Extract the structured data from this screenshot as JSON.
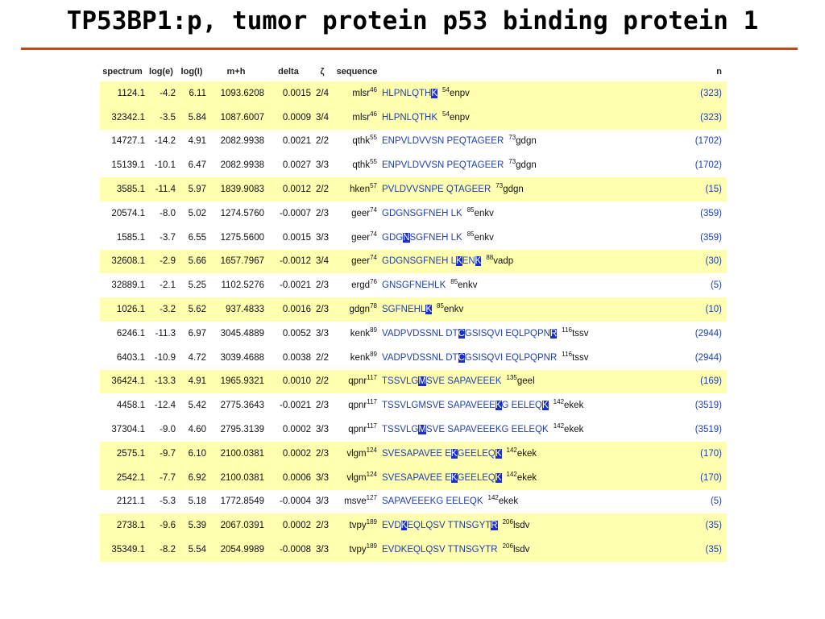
{
  "title": "TP53BP1:p, tumor protein p53 binding protein 1",
  "table": {
    "headers": [
      "spectrum",
      "log(e)",
      "log(I)",
      "m+h",
      "delta",
      "ζ",
      "sequence",
      "n"
    ],
    "rows": [
      {
        "spectrum": "1124.1",
        "loge": "-4.2",
        "logi": "6.11",
        "mh": "1093.6208",
        "delta": "0.0015",
        "z": "2/4",
        "pre": "mlsr",
        "pre_pos": "46",
        "seq_parts": [
          {
            "t": "HLPNLQTH",
            "m": false
          },
          {
            "t": "K",
            "m": true
          }
        ],
        "post_pos": "54",
        "post": "enpv",
        "n": "(323)",
        "hl": true
      },
      {
        "spectrum": "32342.1",
        "loge": "-3.5",
        "logi": "5.84",
        "mh": "1087.6007",
        "delta": "0.0009",
        "z": "3/4",
        "pre": "mlsr",
        "pre_pos": "46",
        "seq_parts": [
          {
            "t": "HLPNLQTHK",
            "m": false
          }
        ],
        "post_pos": "54",
        "post": "enpv",
        "n": "(323)",
        "hl": true
      },
      {
        "spectrum": "14727.1",
        "loge": "-14.2",
        "logi": "4.91",
        "mh": "2082.9938",
        "delta": "0.0021",
        "z": "2/2",
        "pre": "qthk",
        "pre_pos": "55",
        "seq_parts": [
          {
            "t": "ENPVLDVVSN PEQTAGEER",
            "m": false
          }
        ],
        "post_pos": "73",
        "post": "gdgn",
        "n": "(1702)",
        "hl": false
      },
      {
        "spectrum": "15139.1",
        "loge": "-10.1",
        "logi": "6.47",
        "mh": "2082.9938",
        "delta": "0.0027",
        "z": "3/3",
        "pre": "qthk",
        "pre_pos": "55",
        "seq_parts": [
          {
            "t": "ENPVLDVVSN PEQTAGEER",
            "m": false
          }
        ],
        "post_pos": "73",
        "post": "gdgn",
        "n": "(1702)",
        "hl": false
      },
      {
        "spectrum": "3585.1",
        "loge": "-11.4",
        "logi": "5.97",
        "mh": "1839.9083",
        "delta": "0.0012",
        "z": "2/2",
        "pre": "hken",
        "pre_pos": "57",
        "seq_parts": [
          {
            "t": "PVLDVVSNPE QTAGEER",
            "m": false
          }
        ],
        "post_pos": "73",
        "post": "gdgn",
        "n": "(15)",
        "hl": true
      },
      {
        "spectrum": "20574.1",
        "loge": "-8.0",
        "logi": "5.02",
        "mh": "1274.5760",
        "delta": "-0.0007",
        "z": "2/3",
        "pre": "geer",
        "pre_pos": "74",
        "seq_parts": [
          {
            "t": "GDGNSGFNEH LK",
            "m": false
          }
        ],
        "post_pos": "85",
        "post": "enkv",
        "n": "(359)",
        "hl": false
      },
      {
        "spectrum": "1585.1",
        "loge": "-3.7",
        "logi": "6.55",
        "mh": "1275.5600",
        "delta": "0.0015",
        "z": "3/3",
        "pre": "geer",
        "pre_pos": "74",
        "seq_parts": [
          {
            "t": "GDG",
            "m": false
          },
          {
            "t": "N",
            "m": true
          },
          {
            "t": "SGFNEH LK",
            "m": false
          }
        ],
        "post_pos": "85",
        "post": "enkv",
        "n": "(359)",
        "hl": false
      },
      {
        "spectrum": "32608.1",
        "loge": "-2.9",
        "logi": "5.66",
        "mh": "1657.7967",
        "delta": "-0.0012",
        "z": "3/4",
        "pre": "geer",
        "pre_pos": "74",
        "seq_parts": [
          {
            "t": "GDGNSGFNEH L",
            "m": false
          },
          {
            "t": "K",
            "m": true
          },
          {
            "t": "EN",
            "m": false
          },
          {
            "t": "K",
            "m": true
          }
        ],
        "post_pos": "88",
        "post": "vadp",
        "n": "(30)",
        "hl": true
      },
      {
        "spectrum": "32889.1",
        "loge": "-2.1",
        "logi": "5.25",
        "mh": "1102.5276",
        "delta": "-0.0021",
        "z": "2/3",
        "pre": "ergd",
        "pre_pos": "76",
        "seq_parts": [
          {
            "t": "GNSGFNEHLK",
            "m": false
          }
        ],
        "post_pos": "85",
        "post": "enkv",
        "n": "(5)",
        "hl": false
      },
      {
        "spectrum": "1026.1",
        "loge": "-3.2",
        "logi": "5.62",
        "mh": "937.4833",
        "delta": "0.0016",
        "z": "2/3",
        "pre": "gdgn",
        "pre_pos": "78",
        "seq_parts": [
          {
            "t": "SGFNEHL",
            "m": false
          },
          {
            "t": "K",
            "m": true
          }
        ],
        "post_pos": "85",
        "post": "enkv",
        "n": "(10)",
        "hl": true
      },
      {
        "spectrum": "6246.1",
        "loge": "-11.3",
        "logi": "6.97",
        "mh": "3045.4889",
        "delta": "0.0052",
        "z": "3/3",
        "pre": "kenk",
        "pre_pos": "89",
        "seq_parts": [
          {
            "t": "VADPVDSSNL DT",
            "m": false
          },
          {
            "t": "C",
            "m": true
          },
          {
            "t": "GSISQVI EQLPQPN",
            "m": false
          },
          {
            "t": "R",
            "m": true
          }
        ],
        "post_pos": "116",
        "post": "tssv",
        "n": "(2944)",
        "hl": false
      },
      {
        "spectrum": "6403.1",
        "loge": "-10.9",
        "logi": "4.72",
        "mh": "3039.4688",
        "delta": "0.0038",
        "z": "2/2",
        "pre": "kenk",
        "pre_pos": "89",
        "seq_parts": [
          {
            "t": "VADPVDSSNL DT",
            "m": false
          },
          {
            "t": "C",
            "m": true
          },
          {
            "t": "GSISQVI EQLPQPNR",
            "m": false
          }
        ],
        "post_pos": "116",
        "post": "tssv",
        "n": "(2944)",
        "hl": false
      },
      {
        "spectrum": "36424.1",
        "loge": "-13.3",
        "logi": "4.91",
        "mh": "1965.9321",
        "delta": "0.0010",
        "z": "2/2",
        "pre": "qpnr",
        "pre_pos": "117",
        "seq_parts": [
          {
            "t": "TSSVLG",
            "m": false
          },
          {
            "t": "M",
            "m": true
          },
          {
            "t": "SVE SAPAVEEEK",
            "m": false
          }
        ],
        "post_pos": "135",
        "post": "geel",
        "n": "(169)",
        "hl": true
      },
      {
        "spectrum": "4458.1",
        "loge": "-12.4",
        "logi": "5.42",
        "mh": "2775.3643",
        "delta": "-0.0021",
        "z": "2/3",
        "pre": "qpnr",
        "pre_pos": "117",
        "seq_parts": [
          {
            "t": "TSSVLGMSVE SAPAVEEE",
            "m": false
          },
          {
            "t": "K",
            "m": true
          },
          {
            "t": "G EELEQ",
            "m": false
          },
          {
            "t": "K",
            "m": true
          }
        ],
        "post_pos": "142",
        "post": "ekek",
        "n": "(3519)",
        "hl": false
      },
      {
        "spectrum": "37304.1",
        "loge": "-9.0",
        "logi": "4.60",
        "mh": "2795.3139",
        "delta": "0.0002",
        "z": "3/3",
        "pre": "qpnr",
        "pre_pos": "117",
        "seq_parts": [
          {
            "t": "TSSVLG",
            "m": false
          },
          {
            "t": "M",
            "m": true
          },
          {
            "t": "SVE SAPAVEEEKG EELEQK",
            "m": false
          }
        ],
        "post_pos": "142",
        "post": "ekek",
        "n": "(3519)",
        "hl": false
      },
      {
        "spectrum": "2575.1",
        "loge": "-9.7",
        "logi": "6.10",
        "mh": "2100.0381",
        "delta": "0.0002",
        "z": "2/3",
        "pre": "vlgm",
        "pre_pos": "124",
        "seq_parts": [
          {
            "t": "SVESAPAVEE E",
            "m": false
          },
          {
            "t": "K",
            "m": true
          },
          {
            "t": "GEELEQ",
            "m": false
          },
          {
            "t": "K",
            "m": true
          }
        ],
        "post_pos": "142",
        "post": "ekek",
        "n": "(170)",
        "hl": true
      },
      {
        "spectrum": "2542.1",
        "loge": "-7.7",
        "logi": "6.92",
        "mh": "2100.0381",
        "delta": "0.0006",
        "z": "3/3",
        "pre": "vlgm",
        "pre_pos": "124",
        "seq_parts": [
          {
            "t": "SVESAPAVEE E",
            "m": false
          },
          {
            "t": "K",
            "m": true
          },
          {
            "t": "GEELEQ",
            "m": false
          },
          {
            "t": "K",
            "m": true
          }
        ],
        "post_pos": "142",
        "post": "ekek",
        "n": "(170)",
        "hl": true
      },
      {
        "spectrum": "2121.1",
        "loge": "-5.3",
        "logi": "5.18",
        "mh": "1772.8549",
        "delta": "-0.0004",
        "z": "3/3",
        "pre": "msve",
        "pre_pos": "127",
        "seq_parts": [
          {
            "t": "SAPAVEEEKG EELEQK",
            "m": false
          }
        ],
        "post_pos": "142",
        "post": "ekek",
        "n": "(5)",
        "hl": false
      },
      {
        "spectrum": "2738.1",
        "loge": "-9.6",
        "logi": "5.39",
        "mh": "2067.0391",
        "delta": "0.0002",
        "z": "2/3",
        "pre": "tvpy",
        "pre_pos": "189",
        "seq_parts": [
          {
            "t": "EVD",
            "m": false
          },
          {
            "t": "K",
            "m": true
          },
          {
            "t": "EQLQSV TTNSGYT",
            "m": false
          },
          {
            "t": "R",
            "m": true
          }
        ],
        "post_pos": "206",
        "post": "lsdv",
        "n": "(35)",
        "hl": true
      },
      {
        "spectrum": "35349.1",
        "loge": "-8.2",
        "logi": "5.54",
        "mh": "2054.9989",
        "delta": "-0.0008",
        "z": "3/3",
        "pre": "tvpy",
        "pre_pos": "189",
        "seq_parts": [
          {
            "t": "EVDKEQLQSV TTNSGYTR",
            "m": false
          }
        ],
        "post_pos": "206",
        "post": "lsdv",
        "n": "(35)",
        "hl": true
      }
    ]
  },
  "colors": {
    "highlight_row": "#ffffb0",
    "sequence_text": "#1f3fb0",
    "marker_bg": "#1a2fd0",
    "rule": "#c8451a"
  }
}
